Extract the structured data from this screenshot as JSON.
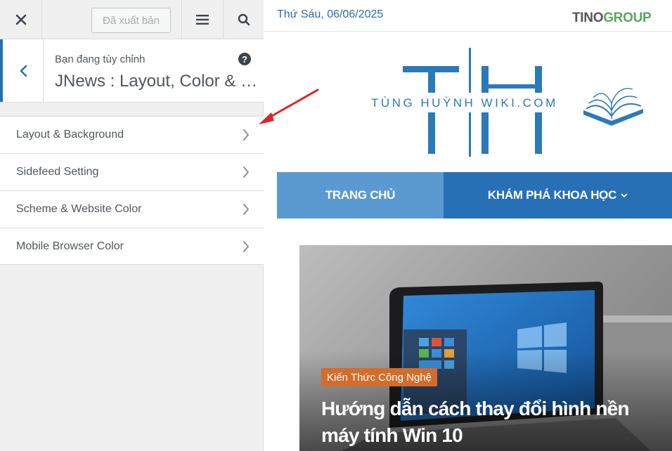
{
  "topbar": {
    "close_icon": "close-icon",
    "published_label": "Đã xuất bản",
    "menu_icon": "hamburger-icon",
    "search_icon": "search-icon"
  },
  "section": {
    "customizing_label": "Bạn đang tùy chỉnh",
    "title": "JNews : Layout, Color & Scheme"
  },
  "menu": {
    "items": [
      {
        "label": "Layout & Background"
      },
      {
        "label": "Sidefeed Setting"
      },
      {
        "label": "Scheme & Website Color"
      },
      {
        "label": "Mobile Browser Color"
      }
    ]
  },
  "preview": {
    "date": "Thứ Sáu, 06/06/2025",
    "partner_logo": {
      "part1": "TINO",
      "part2": "GROUP"
    },
    "site_logo_text": "TÙNG HUỲNH WIKI.COM",
    "nav": {
      "home": "TRANG CHỦ",
      "explore": "KHÁM PHÁ KHOA HỌC"
    },
    "featured": {
      "category": "Kiến Thức Công Nghệ",
      "headline": "Hướng dẫn cách thay đổi hình nền máy tính Win 10"
    }
  },
  "colors": {
    "accent": "#2271b1",
    "nav_home": "#5a9ad1",
    "nav_explore": "#2770b6",
    "category_badge": "#d46c2b",
    "annotation_arrow": "#e02424"
  }
}
